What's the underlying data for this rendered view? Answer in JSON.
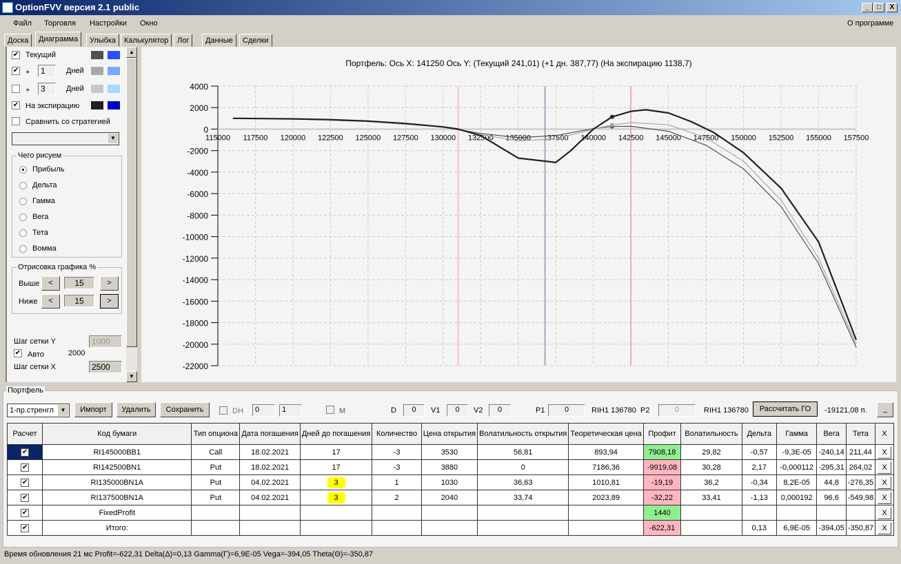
{
  "window": {
    "title": "OptionFVV версия 2.1 public",
    "min": "_",
    "max": "□",
    "close": "X"
  },
  "menu": {
    "items": [
      "Файл",
      "Торговля",
      "Настройки",
      "Окно"
    ],
    "about": "О программе"
  },
  "tabs": [
    "Доска",
    "Диаграмма",
    "Улыбка",
    "Калькулятор",
    "Лог",
    "Данные",
    "Сделки"
  ],
  "left": {
    "current": {
      "label": "Текущий",
      "checked": true,
      "colors": [
        "#505050",
        "#2850ff"
      ]
    },
    "day1": {
      "plus": "+",
      "value": "1",
      "label": "Дней",
      "checked": true,
      "colors": [
        "#a8a8a8",
        "#78a8ff"
      ]
    },
    "day3": {
      "plus": "+",
      "value": "3",
      "label": "Дней",
      "checked": false,
      "colors": [
        "#c8c8c8",
        "#a8d8ff"
      ]
    },
    "expiry": {
      "label": "На экспирацию",
      "checked": true,
      "colors": [
        "#202020",
        "#0000c8"
      ]
    },
    "compare": {
      "label": "Сравнить со стратегией",
      "checked": false
    },
    "what_title": "Чего рисуем",
    "what": [
      "Прибыль",
      "Дельта",
      "Гамма",
      "Вега",
      "Тета",
      "Вомма"
    ],
    "what_selected": 0,
    "draw_title": "Отрисовка графика %",
    "above": {
      "label": "Выше",
      "value": "15"
    },
    "below": {
      "label": "Ниже",
      "value": "15"
    },
    "prev": "<",
    "next": ">",
    "grid_y": {
      "label": "Шаг сетки Y",
      "value": "1000"
    },
    "auto": {
      "label": "Авто",
      "value": "2000",
      "checked": true
    },
    "grid_x": {
      "label": "Шаг сетки X",
      "value": "2500"
    }
  },
  "chart_data": {
    "type": "line",
    "title": "Портфель: Ось X: 141250 Ось Y:  (Текущий 241,01)  (+1 дн. 387,77)  (На экспирацию 1138,7)",
    "xlim": [
      115000,
      157500
    ],
    "ylim": [
      -22000,
      4000
    ],
    "xticks": [
      115000,
      117500,
      120000,
      122500,
      125000,
      127500,
      130000,
      132500,
      135000,
      137500,
      140000,
      142500,
      145000,
      147500,
      150000,
      152500,
      155000,
      157500
    ],
    "yticks": [
      4000,
      2000,
      0,
      -2000,
      -4000,
      -6000,
      -8000,
      -10000,
      -12000,
      -14000,
      -16000,
      -18000,
      -20000,
      -22000
    ],
    "grid": true,
    "vlines": [
      {
        "x": 131000,
        "color": "#ffb0b8"
      },
      {
        "x": 136780,
        "color": "#8898b0"
      },
      {
        "x": 142500,
        "color": "#ff9098"
      }
    ],
    "cursor_x": 141250,
    "series": [
      {
        "name": "Текущий",
        "color": "#505050",
        "width": 1.2,
        "marker": 241.01,
        "points": [
          [
            116000,
            1000
          ],
          [
            120000,
            950
          ],
          [
            125000,
            700
          ],
          [
            130000,
            200
          ],
          [
            132500,
            -400
          ],
          [
            135000,
            -800
          ],
          [
            137500,
            -600
          ],
          [
            140000,
            50
          ],
          [
            141250,
            241
          ],
          [
            142500,
            260
          ],
          [
            145000,
            -200
          ],
          [
            147500,
            -1500
          ],
          [
            150000,
            -3700
          ],
          [
            152500,
            -7200
          ],
          [
            155000,
            -12500
          ],
          [
            157500,
            -20300
          ]
        ]
      },
      {
        "name": "+1 дн.",
        "color": "#a8a8a8",
        "width": 1.2,
        "marker": 387.77,
        "points": [
          [
            116000,
            1000
          ],
          [
            120000,
            950
          ],
          [
            125000,
            700
          ],
          [
            130000,
            200
          ],
          [
            132500,
            -500
          ],
          [
            135000,
            -1100
          ],
          [
            137500,
            -900
          ],
          [
            140000,
            0
          ],
          [
            141250,
            388
          ],
          [
            142500,
            600
          ],
          [
            145000,
            400
          ],
          [
            147500,
            -800
          ],
          [
            150000,
            -3000
          ],
          [
            152500,
            -6600
          ],
          [
            155000,
            -12000
          ],
          [
            157500,
            -20000
          ]
        ]
      },
      {
        "name": "На экспирацию",
        "color": "#202020",
        "width": 2.2,
        "marker": 1138.7,
        "points": [
          [
            116000,
            1000
          ],
          [
            120000,
            950
          ],
          [
            122500,
            880
          ],
          [
            125000,
            750
          ],
          [
            127500,
            520
          ],
          [
            130000,
            200
          ],
          [
            131000,
            0
          ],
          [
            132500,
            -600
          ],
          [
            135000,
            -2700
          ],
          [
            137500,
            -3100
          ],
          [
            138500,
            -2000
          ],
          [
            140000,
            0
          ],
          [
            141250,
            1139
          ],
          [
            142500,
            1650
          ],
          [
            143500,
            1800
          ],
          [
            145000,
            1500
          ],
          [
            146500,
            700
          ],
          [
            148000,
            -300
          ],
          [
            150000,
            -2200
          ],
          [
            152500,
            -5500
          ],
          [
            155000,
            -10500
          ],
          [
            157500,
            -19600
          ]
        ]
      }
    ]
  },
  "portfolio": {
    "title": "Портфель",
    "strategy": "1-пр.стренгл",
    "import": "Импорт",
    "delete": "Удалить",
    "save": "Сохранить",
    "dh": "DH",
    "spin1": "0",
    "spin2": "1",
    "m": "M",
    "d_label": "D",
    "d": "0",
    "v1_label": "V1",
    "v1": "0",
    "v2_label": "V2",
    "v2": "0",
    "p1_label": "P1",
    "p1": "0",
    "rih1": "RIH1 136780",
    "p2_label": "P2",
    "p2": "0",
    "rih2": "RIH1 136780",
    "calc_go": "Рассчитать ГО",
    "go_value": "-19121,08 п.",
    "minimize": "_",
    "columns": [
      "Расчет",
      "Код бумаги",
      "Тип опциона",
      "Дата погашения",
      "Дней до погашения",
      "Количество",
      "Цена открытия",
      "Волатильность открытия",
      "Теоретическая цена",
      "Профит",
      "Волатильность",
      "Дельта",
      "Гамма",
      "Вега",
      "Тета",
      "X"
    ],
    "rows": [
      {
        "code": "RI145000BB1",
        "type": "Call",
        "date": "18.02.2021",
        "days": "17",
        "qty": "-3",
        "open": "3530",
        "vol_open": "56,81",
        "theor": "893,94",
        "profit": "7908,18",
        "pc": "green",
        "vol": "29,82",
        "delta": "-0,57",
        "gamma": "-9,3E-05",
        "vega": "-240,14",
        "theta": "211,44"
      },
      {
        "code": "RI142500BN1",
        "type": "Put",
        "date": "18.02.2021",
        "days": "17",
        "qty": "-3",
        "open": "3880",
        "vol_open": "0",
        "theor": "7186,36",
        "profit": "-9919,08",
        "pc": "red",
        "vol": "30,28",
        "delta": "2,17",
        "gamma": "-0,000112",
        "vega": "-295,31",
        "theta": "264,02"
      },
      {
        "code": "RI135000BN1A",
        "type": "Put",
        "date": "04.02.2021",
        "days": "3",
        "qty": "1",
        "open": "1030",
        "vol_open": "36,63",
        "theor": "1010,81",
        "profit": "-19,19",
        "pc": "red",
        "vol": "36,2",
        "delta": "-0,34",
        "gamma": "8,2E-05",
        "vega": "44,8",
        "theta": "-276,35"
      },
      {
        "code": "RI137500BN1A",
        "type": "Put",
        "date": "04.02.2021",
        "days": "3",
        "qty": "2",
        "open": "2040",
        "vol_open": "33,74",
        "theor": "2023,89",
        "profit": "-32,22",
        "pc": "red",
        "vol": "33,41",
        "delta": "-1,13",
        "gamma": "0,000192",
        "vega": "96,6",
        "theta": "-549,98"
      },
      {
        "code": "FixedProfit",
        "type": "",
        "date": "",
        "days": "",
        "qty": "",
        "open": "",
        "vol_open": "",
        "theor": "",
        "profit": "1440",
        "pc": "green",
        "vol": "",
        "delta": "",
        "gamma": "",
        "vega": "",
        "theta": ""
      },
      {
        "code": "Итого:",
        "type": "",
        "date": "",
        "days": "",
        "qty": "",
        "open": "",
        "vol_open": "",
        "theor": "",
        "profit": "-622,31",
        "pc": "red",
        "vol": "",
        "delta": "0,13",
        "gamma": "6,9E-05",
        "vega": "-394,05",
        "theta": "-350,87"
      }
    ],
    "remove": "X"
  },
  "status": "Время обновления 21 мс  Profit=-622,31 Delta(Δ)=0,13 Gamma(Γ)=6,9E-05 Vega=-394,05 Theta(Θ)=-350,87"
}
